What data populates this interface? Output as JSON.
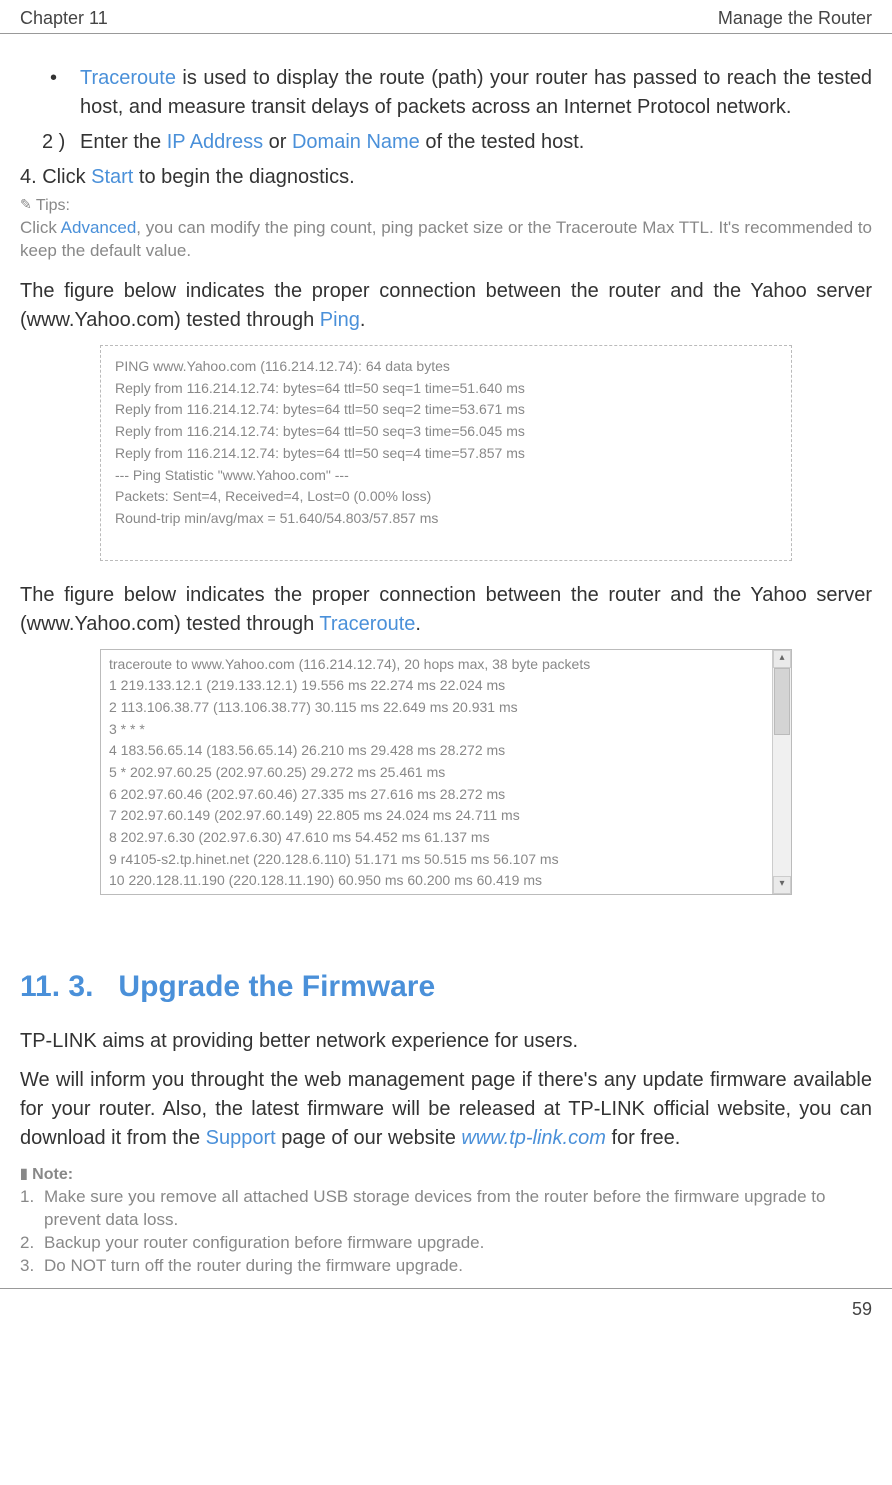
{
  "header": {
    "chapter": "Chapter 11",
    "title": "Manage the Router"
  },
  "bullet1": {
    "term": "Traceroute",
    "text": " is used to display the route (path) your router has passed to reach the tested host, and measure transit delays of packets across an Internet Protocol network."
  },
  "step2": {
    "num": "2 )",
    "pre": "Enter the ",
    "ip": "IP Address",
    "or": " or ",
    "domain": "Domain Name",
    "post": " of the tested host."
  },
  "step4": {
    "pre": "4. Click ",
    "start": "Start",
    "post": " to begin the diagnostics."
  },
  "tips": {
    "label": "Tips:",
    "pre": "Click ",
    "adv": "Advanced",
    "post": ", you can modify the ping count, ping packet size or the Traceroute Max TTL. It's recommended to keep the default value."
  },
  "para1": {
    "pre": "The figure below indicates the proper connection between the router and the Yahoo server (www.Yahoo.com) tested through ",
    "tool": "Ping",
    "post": "."
  },
  "ping_output": {
    "l1": "PING www.Yahoo.com (116.214.12.74): 64 data bytes",
    "l2": "Reply from 116.214.12.74:  bytes=64  ttl=50  seq=1  time=51.640 ms",
    "l3": "Reply from 116.214.12.74:  bytes=64  ttl=50  seq=2  time=53.671 ms",
    "l4": "Reply from 116.214.12.74:  bytes=64  ttl=50  seq=3  time=56.045 ms",
    "l5": "Reply from 116.214.12.74:  bytes=64  ttl=50  seq=4  time=57.857 ms",
    "l6": "",
    "l7": "--- Ping Statistic \"www.Yahoo.com\" ---",
    "l8": "Packets: Sent=4, Received=4, Lost=0 (0.00% loss)",
    "l9": "Round-trip min/avg/max = 51.640/54.803/57.857 ms"
  },
  "para2": {
    "pre": "The figure below indicates the proper connection between the router and the Yahoo server (www.Yahoo.com) tested through ",
    "tool": "Traceroute",
    "post": "."
  },
  "trace_output": {
    "l0": "traceroute to www.Yahoo.com (116.214.12.74), 20 hops max, 38 byte packets",
    "l1": "1   219.133.12.1 (219.133.12.1)  19.556 ms  22.274 ms  22.024 ms",
    "l2": "2   113.106.38.77 (113.106.38.77)  30.115 ms  22.649 ms  20.931 ms",
    "l3": "3   *  *  *",
    "l4": "4   183.56.65.14 (183.56.65.14)  26.210 ms  29.428 ms  28.272 ms",
    "l5": "5   *   202.97.60.25 (202.97.60.25)  29.272 ms  25.461 ms",
    "l6": "6   202.97.60.46 (202.97.60.46)  27.335 ms  27.616 ms  28.272 ms",
    "l7": "7   202.97.60.149 (202.97.60.149)  22.805 ms  24.024 ms  24.711 ms",
    "l8": "8   202.97.6.30 (202.97.6.30)  47.610 ms  54.452 ms  61.137 ms",
    "l9": "9   r4105-s2.tp.hinet.net (220.128.6.110)  51.171 ms  50.515 ms  56.107 ms",
    "l10": "10  220.128.11.190 (220.128.11.190)  60.950 ms  60.200 ms  60.419 ms"
  },
  "section": {
    "num": "11. 3.",
    "title": "Upgrade the Firmware"
  },
  "para3": "TP-LINK aims at providing better network experience for users.",
  "para4": {
    "pre": "We will inform you throught the web management page if there's any update firmware available for your router. Also, the latest firmware will be released at TP-LINK official website, you can download it from the ",
    "support": "Support",
    "mid": " page of our website ",
    "url": "www.tp-link.com",
    "post": " for free."
  },
  "note": {
    "label": "Note:",
    "n1": "Make sure you remove all attached USB storage devices  from the router before the firmware upgrade to prevent data loss.",
    "n2": "Backup your router configuration before firmware upgrade.",
    "n3": "Do NOT turn off the router during the firmware upgrade."
  },
  "page": "59"
}
